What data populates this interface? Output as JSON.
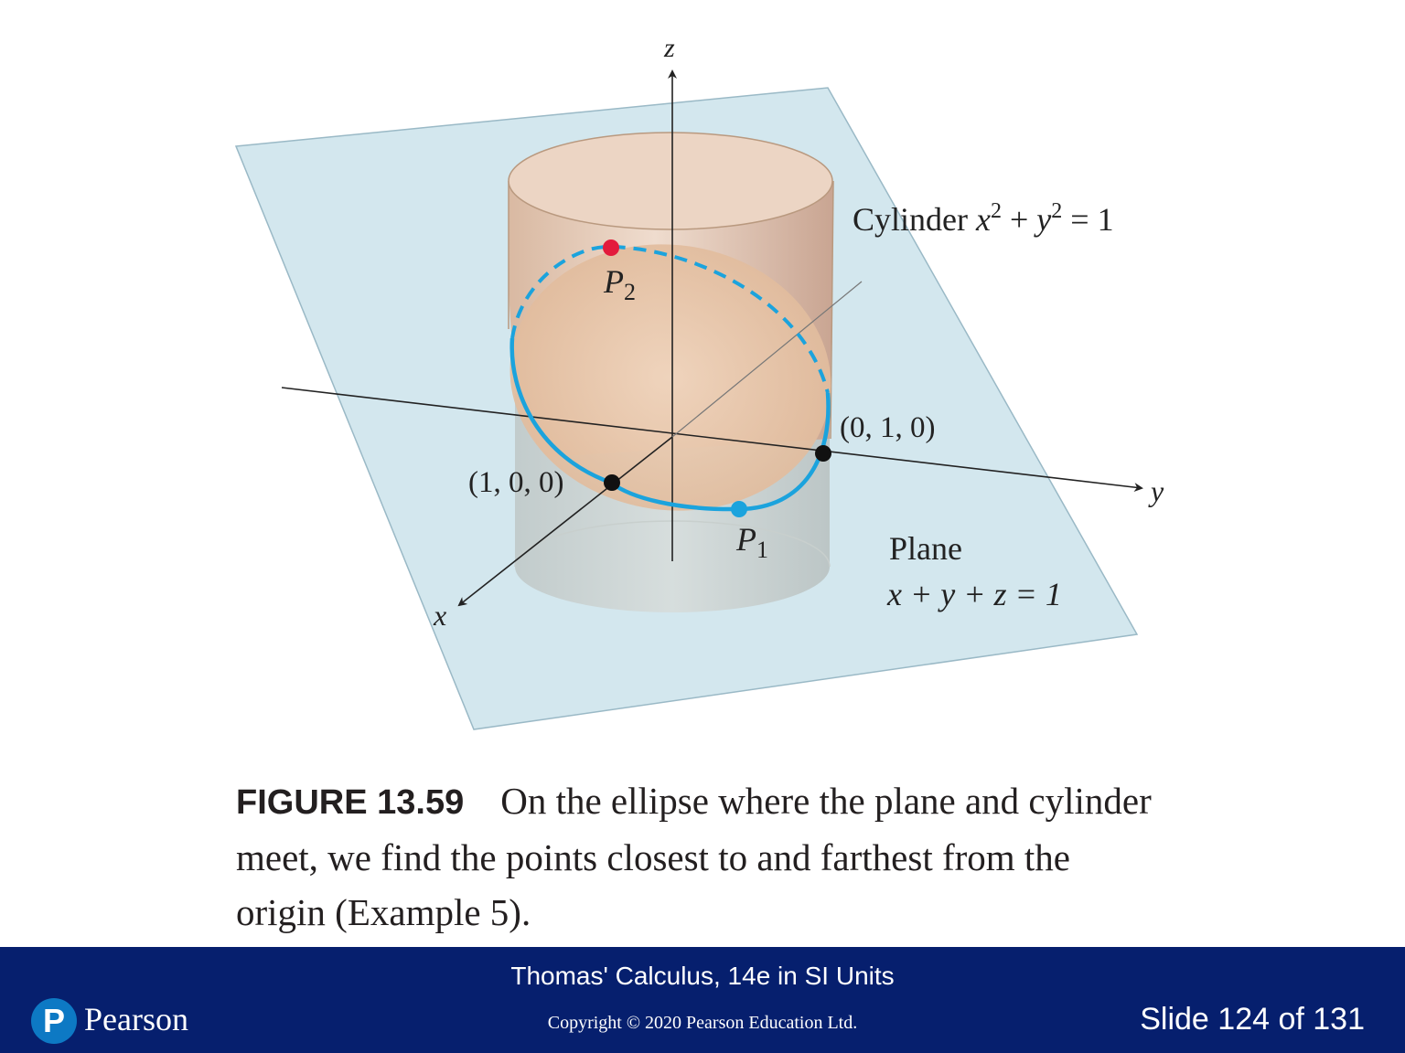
{
  "figure": {
    "axes": {
      "x": "x",
      "y": "y",
      "z": "z"
    },
    "cylinder_label": {
      "prefix": "Cylinder ",
      "x": "x",
      "exp1": "2",
      "plus": " + ",
      "y": "y",
      "exp2": "2",
      "eq": " = 1"
    },
    "plane_label": {
      "word": "Plane",
      "equation": "x + y + z = 1"
    },
    "points": {
      "p2": {
        "letter": "P",
        "sub": "2"
      },
      "p1": {
        "letter": "P",
        "sub": "1"
      },
      "pt_100": "(1, 0, 0)",
      "pt_010": "(0, 1, 0)"
    },
    "colors": {
      "plane": "#d3e7ee",
      "cylinder": "#e6cab7",
      "ellipse": "#1ba3dd",
      "p2": "#e31b3c",
      "p1": "#1ba3dd",
      "axis": "#222222"
    }
  },
  "caption": {
    "label": "FIGURE 13.59",
    "text": "On the ellipse where the plane and cylinder meet, we find the points closest to and farthest from the origin (Example 5)."
  },
  "footer": {
    "logo_text": "Pearson",
    "logo_mark": "P",
    "course": "Thomas' Calculus, 14e in SI Units",
    "copyright": "Copyright © 2020 Pearson Education Ltd.",
    "slide": "Slide 124 of 131"
  }
}
